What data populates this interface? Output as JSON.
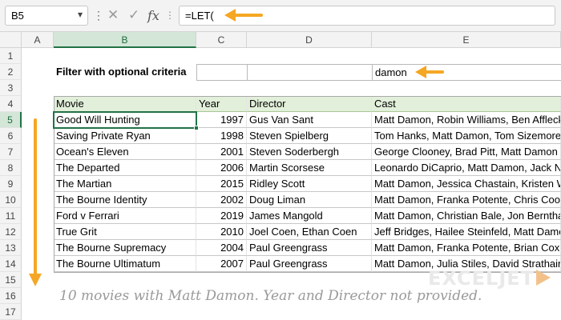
{
  "formula_bar": {
    "name_box": "B5",
    "name_box_arrow": "▾",
    "more": "⋮",
    "cancel_glyph": "✕",
    "enter_glyph": "✓",
    "fx_glyph": "fx",
    "formula": "=LET("
  },
  "columns": [
    "A",
    "B",
    "C",
    "D",
    "E"
  ],
  "rows": [
    "1",
    "2",
    "3",
    "4",
    "5",
    "6",
    "7",
    "8",
    "9",
    "10",
    "11",
    "12",
    "13",
    "14",
    "15",
    "16",
    "17"
  ],
  "sheet": {
    "title": "Filter with optional criteria",
    "criteria": {
      "year": "",
      "director": "",
      "cast": "damon"
    },
    "headers": [
      "Movie",
      "Year",
      "Director",
      "Cast"
    ],
    "data": [
      [
        "Good Will Hunting",
        "1997",
        "Gus Van Sant",
        "Matt Damon, Robin Williams, Ben Affleck"
      ],
      [
        "Saving Private Ryan",
        "1998",
        "Steven Spielberg",
        "Tom Hanks, Matt Damon, Tom Sizemore"
      ],
      [
        "Ocean's Eleven",
        "2001",
        "Steven Soderbergh",
        "George Clooney, Brad Pitt, Matt Damon"
      ],
      [
        "The Departed",
        "2006",
        "Martin Scorsese",
        "Leonardo DiCaprio, Matt Damon, Jack Nicholson"
      ],
      [
        "The Martian",
        "2015",
        "Ridley Scott",
        "Matt Damon, Jessica Chastain, Kristen Wiig"
      ],
      [
        "The Bourne Identity",
        "2002",
        "Doug Liman",
        "Matt Damon, Franka Potente, Chris Cooper"
      ],
      [
        "Ford v Ferrari",
        "2019",
        "James Mangold",
        "Matt Damon, Christian Bale, Jon Bernthal"
      ],
      [
        "True Grit",
        "2010",
        "Joel Coen, Ethan Coen",
        "Jeff Bridges, Hailee Steinfeld, Matt Damon"
      ],
      [
        "The Bourne Supremacy",
        "2004",
        "Paul Greengrass",
        "Matt Damon, Franka Potente, Brian Cox"
      ],
      [
        "The Bourne Ultimatum",
        "2007",
        "Paul Greengrass",
        "Matt Damon, Julia Stiles, David Strathairn"
      ]
    ]
  },
  "note": "10 movies with Matt Damon. Year and Director not provided.",
  "logo": "EXCELJET",
  "colors": {
    "arrow": "#f5a623",
    "header_fill": "#e2efda",
    "selection": "#217346"
  }
}
